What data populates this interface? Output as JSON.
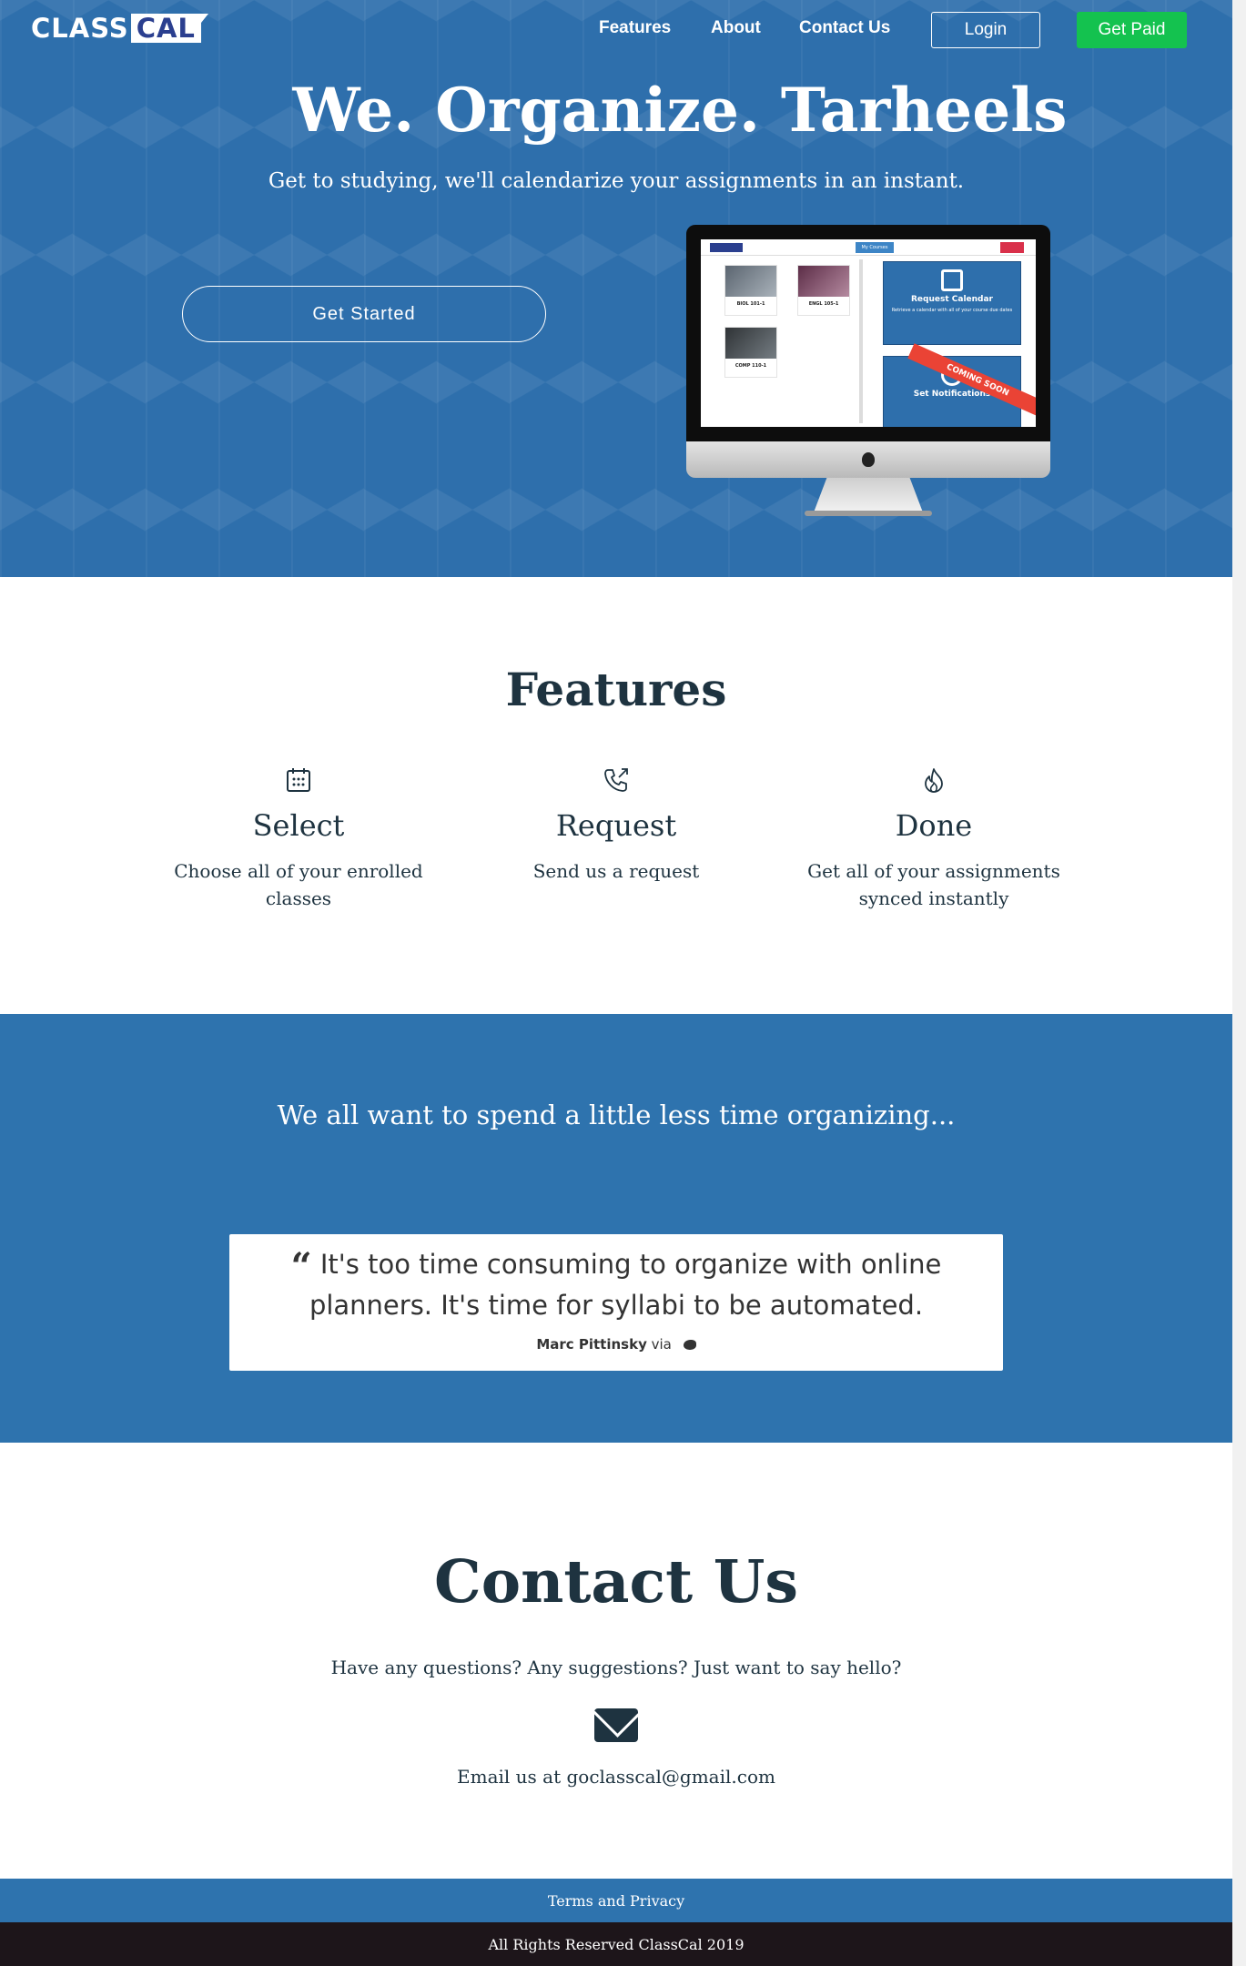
{
  "header": {
    "logo_part1": "CLASS",
    "logo_part2": "CAL",
    "nav": {
      "features": "Features",
      "about": "About",
      "contact": "Contact Us"
    },
    "login_label": "Login",
    "get_paid_label": "Get Paid"
  },
  "hero": {
    "title": "We. Organize. Tarheels",
    "subtitle": "Get to studying, we'll calendarize your assignments in an instant.",
    "cta_label": "Get Started",
    "screen": {
      "my_courses": "My Courses",
      "courses": [
        "BIOL 101-1",
        "ENGL 105-1",
        "COMP 110-1"
      ],
      "card1_title": "Request Calendar",
      "card1_desc": "Retrieve a calendar with all of your course due dates",
      "card2_title": "Set Notifications",
      "ribbon": "COMING SOON"
    }
  },
  "features": {
    "title": "Features",
    "items": [
      {
        "icon": "calendar-icon",
        "name": "Select",
        "desc": "Choose all of your enrolled classes"
      },
      {
        "icon": "phone-outgoing-icon",
        "name": "Request",
        "desc": "Send us a request"
      },
      {
        "icon": "flame-icon",
        "name": "Done",
        "desc": "Get all of your assignments synced instantly"
      }
    ]
  },
  "testimonial": {
    "lead": "We all want to spend a little less time organizing...",
    "quote": "It's too time consuming to organize with online planners. It's time for syllabi to be automated.",
    "author": "Marc Pittinsky",
    "via": "via"
  },
  "contact": {
    "title": "Contact Us",
    "subtitle": "Have any questions? Any suggestions? Just want to say hello?",
    "email_text": "Email us at goclasscal@gmail.com"
  },
  "footer": {
    "terms": "Terms and Privacy",
    "copyright": "All Rights Reserved ClassCal 2019"
  },
  "colors": {
    "primary_blue": "#2e6fac",
    "accent_green": "#14c24f",
    "dark_text": "#1e3340",
    "footer_dark": "#1d151a"
  }
}
